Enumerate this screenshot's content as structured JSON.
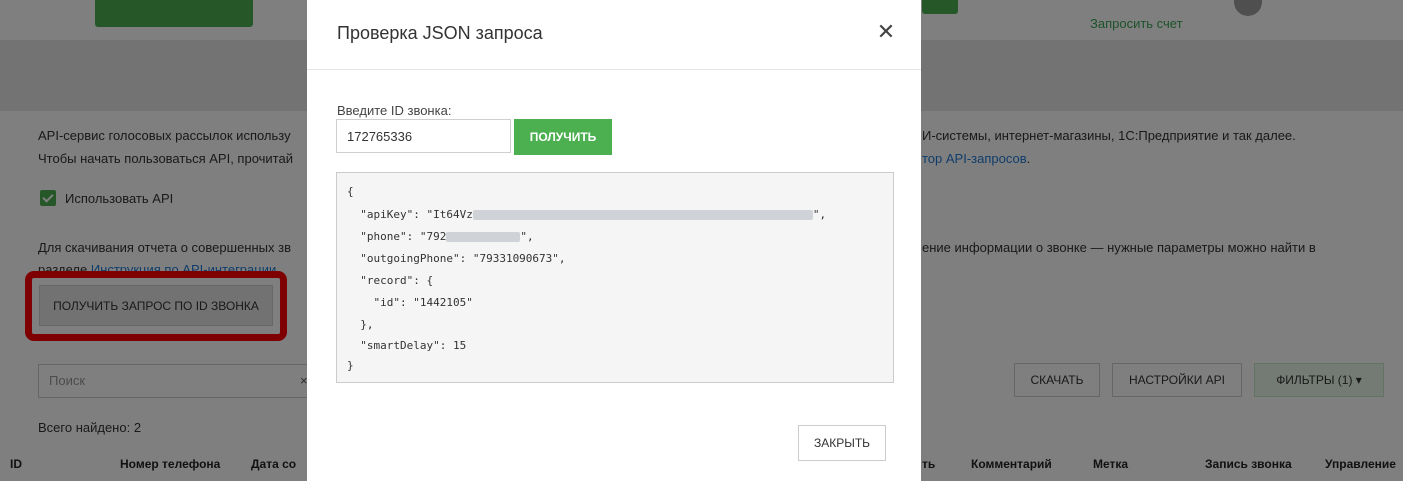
{
  "background": {
    "top_link": "Запросить счет",
    "description": {
      "line1_left": "API-сервис голосовых рассылок использу",
      "line1_right": "И-системы, интернет-магазины, 1С:Предприятие и так далее.",
      "line2_left": "Чтобы начать пользоваться API, прочитай",
      "line2_right_link": "тор API-запросов",
      "line2_right_end": "."
    },
    "use_api_label": "Использовать API",
    "report": {
      "line1_left": "Для скачивания отчета о совершенных зв",
      "line1_right": "ение информации о звонке — нужные параметры можно найти в",
      "line2_prefix": "разделе ",
      "line2_link": "Инструкция по API-интеграции"
    },
    "get_request_button": "Получить запрос по ID звонка",
    "search_placeholder": "Поиск",
    "search_clear": "×",
    "buttons": {
      "download": "Скачать",
      "api_settings": "Настройки API",
      "filters": "Фильтры (1) ▾"
    },
    "found_text": "Всего найдено: 2",
    "table_headers": {
      "id": "ID",
      "phone": "Номер телефона",
      "date": "Дата со",
      "status_tail": "ть",
      "comment": "Комментарий",
      "tag": "Метка",
      "record": "Запись звонка",
      "manage": "Управление"
    },
    "colors": {
      "accent": "#4caf50",
      "link": "#1e7ad6",
      "highlight": "#ff0000"
    }
  },
  "modal": {
    "title": "Проверка JSON запроса",
    "close_icon": "close-icon",
    "close_glyph": "✕",
    "id_label": "Введите ID звонка:",
    "id_value": "172765336",
    "get_button": "Получить",
    "json_lines": {
      "l1": "{",
      "l2_prefix": "  \"apiKey\": \"It64Vz",
      "l2_suffix": "\",",
      "l3_prefix": "  \"phone\": \"792",
      "l3_suffix": "\",",
      "l4": "  \"outgoingPhone\": \"79331090673\",",
      "l5": "  \"record\": {",
      "l6": "    \"id\": \"1442105\"",
      "l7": "  },",
      "l8": "  \"smartDelay\": 15",
      "l9": "}"
    },
    "close_button": "Закрыть"
  }
}
